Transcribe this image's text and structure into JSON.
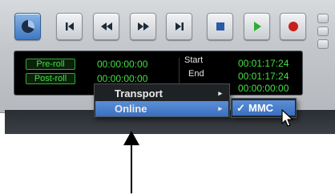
{
  "transport": {
    "buttons": [
      {
        "name": "online",
        "icon": "online-clock-icon"
      },
      {
        "name": "return-to-zero",
        "icon": "return-to-zero-icon"
      },
      {
        "name": "rewind",
        "icon": "rewind-icon"
      },
      {
        "name": "fast-forward",
        "icon": "fast-forward-icon"
      },
      {
        "name": "go-to-end",
        "icon": "go-to-end-icon"
      },
      {
        "name": "stop",
        "icon": "stop-icon"
      },
      {
        "name": "play",
        "icon": "play-icon"
      },
      {
        "name": "record",
        "icon": "record-icon"
      }
    ],
    "colors": {
      "online": "#3d78c2",
      "stop": "#2a5aa8",
      "play": "#2fae2f",
      "record": "#c81e1e",
      "counter_text": "#44e044"
    }
  },
  "counters": {
    "pre_roll_label": "Pre-roll",
    "post_roll_label": "Post-roll",
    "pre_roll_value": "00:00:00:00",
    "post_roll_value": "00:00:00:00",
    "start_label": "Start",
    "end_label": "End",
    "start_value": "00:01:17:24",
    "end_value": "00:01:17:24",
    "length_value": "00:00:00:00"
  },
  "context_menu": {
    "items": [
      {
        "label": "Transport",
        "arrow": "▸"
      },
      {
        "label": "Online",
        "arrow": "▸"
      }
    ]
  },
  "submenu": {
    "item": {
      "check": "✓",
      "label": "MMC"
    }
  }
}
